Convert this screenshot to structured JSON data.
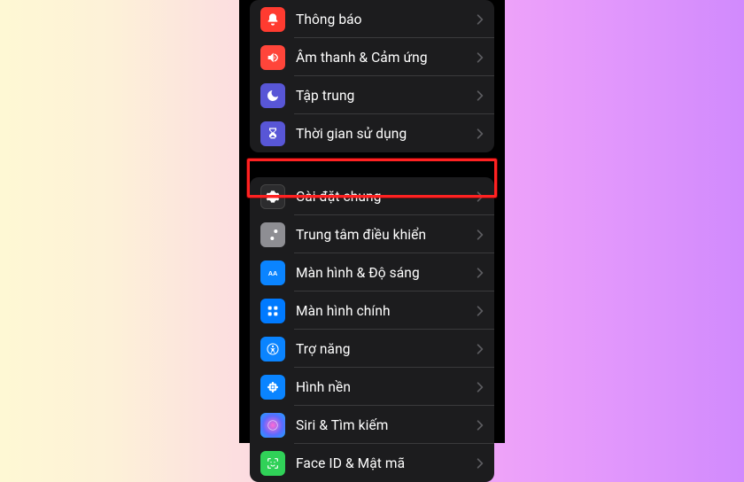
{
  "groups": [
    {
      "rows": [
        {
          "id": "notifications",
          "label": "Thông báo",
          "icon": "bell-icon",
          "iconBg": "ic-bg-red"
        },
        {
          "id": "sounds",
          "label": "Âm thanh & Cảm ứng",
          "icon": "speaker-icon",
          "iconBg": "ic-bg-orange"
        },
        {
          "id": "focus",
          "label": "Tập trung",
          "icon": "moon-icon",
          "iconBg": "ic-bg-indigo"
        },
        {
          "id": "screen-time",
          "label": "Thời gian sử dụng",
          "icon": "hourglass-icon",
          "iconBg": "ic-bg-indigo"
        }
      ]
    },
    {
      "rows": [
        {
          "id": "general",
          "label": "Cài đặt chung",
          "icon": "gear-icon",
          "iconBg": "ic-bg-gray-dark",
          "highlight": true
        },
        {
          "id": "control-center",
          "label": "Trung tâm điều khiển",
          "icon": "sliders-icon",
          "iconBg": "ic-bg-gray"
        },
        {
          "id": "display",
          "label": "Màn hình & Độ sáng",
          "icon": "display-brightness-icon",
          "iconBg": "ic-bg-blue"
        },
        {
          "id": "home-screen",
          "label": "Màn hình chính",
          "icon": "grid-apps-icon",
          "iconBg": "ic-bg-blue2"
        },
        {
          "id": "accessibility",
          "label": "Trợ năng",
          "icon": "accessibility-icon",
          "iconBg": "ic-bg-cyan"
        },
        {
          "id": "wallpaper",
          "label": "Hình nền",
          "icon": "flower-icon",
          "iconBg": "ic-bg-cyan"
        },
        {
          "id": "siri",
          "label": "Siri & Tìm kiếm",
          "icon": "siri-icon",
          "iconBg": "ic-bg-siri"
        },
        {
          "id": "faceid",
          "label": "Face ID & Mật mã",
          "icon": "face-id-icon",
          "iconBg": "ic-bg-green"
        }
      ]
    }
  ]
}
